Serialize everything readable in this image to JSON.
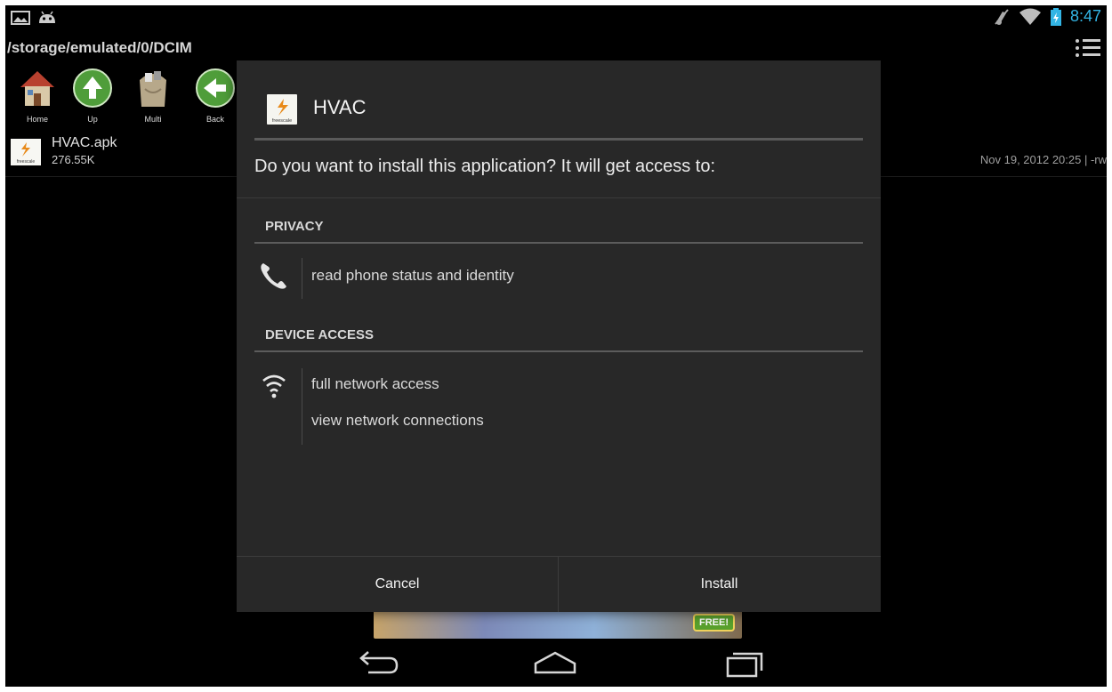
{
  "status_bar": {
    "clock": "8:47",
    "icons": [
      "gallery-icon",
      "android-icon",
      "mute-icon",
      "wifi-icon",
      "battery-icon"
    ]
  },
  "file_manager": {
    "path": "/storage/emulated/0/DCIM",
    "toolbar": [
      {
        "label": "Home",
        "icon": "home-icon"
      },
      {
        "label": "Up",
        "icon": "up-arrow-icon"
      },
      {
        "label": "Multi",
        "icon": "multi-icon"
      },
      {
        "label": "Back",
        "icon": "back-arrow-icon"
      }
    ],
    "file": {
      "name": "HVAC.apk",
      "size": "276.55K",
      "meta": "Nov 19, 2012 20:25 | -rw"
    }
  },
  "ad": {
    "badge": "FREE!"
  },
  "dialog": {
    "app_name": "HVAC",
    "question": "Do you want to install this application? It will get access to:",
    "sections": [
      {
        "title": "PRIVACY",
        "icon": "phone-icon",
        "permissions": [
          "read phone status and identity"
        ]
      },
      {
        "title": "DEVICE ACCESS",
        "icon": "wifi-icon",
        "permissions": [
          "full network access",
          "view network connections"
        ]
      }
    ],
    "cancel_label": "Cancel",
    "install_label": "Install"
  },
  "colors": {
    "accent": "#33b5e5",
    "dialog_bg": "#282828",
    "screen_bg": "#000000"
  }
}
